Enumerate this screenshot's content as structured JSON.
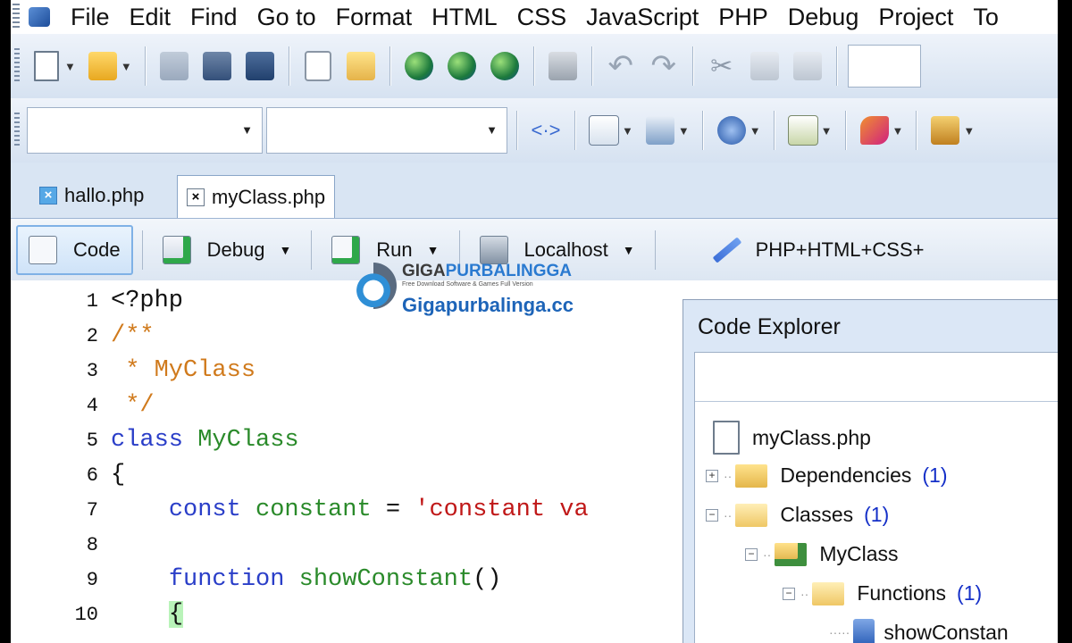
{
  "menubar": {
    "items": [
      "File",
      "Edit",
      "Find",
      "Go to",
      "Format",
      "HTML",
      "CSS",
      "JavaScript",
      "PHP",
      "Debug",
      "Project",
      "To"
    ]
  },
  "tabs": [
    {
      "label": "hallo.php"
    },
    {
      "label": "myClass.php"
    }
  ],
  "modebar": {
    "code": "Code",
    "debug": "Debug",
    "run": "Run",
    "localhost": "Localhost",
    "language": "PHP+HTML+CSS+"
  },
  "editor": {
    "lines": [
      {
        "n": "1"
      },
      {
        "n": "2"
      },
      {
        "n": "3"
      },
      {
        "n": "4"
      },
      {
        "n": "5"
      },
      {
        "n": "6"
      },
      {
        "n": "7"
      },
      {
        "n": "8"
      },
      {
        "n": "9"
      },
      {
        "n": "10"
      }
    ],
    "code": {
      "l1": "<?php",
      "l2": "/**",
      "l3": " * MyClass",
      "l4": " */",
      "l5_kw": "class",
      "l5_cls": "MyClass",
      "l6": "{",
      "l7_kw": "const",
      "l7_name": "constant",
      "l7_eq": " = ",
      "l7_str": "'constant va",
      "l9_kw": "function",
      "l9_name": "showConstant",
      "l9_paren": "()",
      "l10": "{"
    }
  },
  "explorer": {
    "title": "Code Explorer",
    "file": "myClass.php",
    "dependencies": {
      "label": "Dependencies",
      "count": "(1)"
    },
    "classes": {
      "label": "Classes",
      "count": "(1)"
    },
    "myclass": "MyClass",
    "functions": {
      "label": "Functions",
      "count": "(1)"
    },
    "method": "showConstan"
  },
  "watermark": {
    "brand_a": "GIGA",
    "brand_b": "PURBALINGGA",
    "tagline": "Free Download Software & Games Full Version",
    "site": "Gigapurbalinga.cc"
  },
  "colors": {
    "keyword": "#2a3ec8",
    "classname": "#2a8a2a",
    "comment": "#d07a1c",
    "string": "#c01818"
  }
}
